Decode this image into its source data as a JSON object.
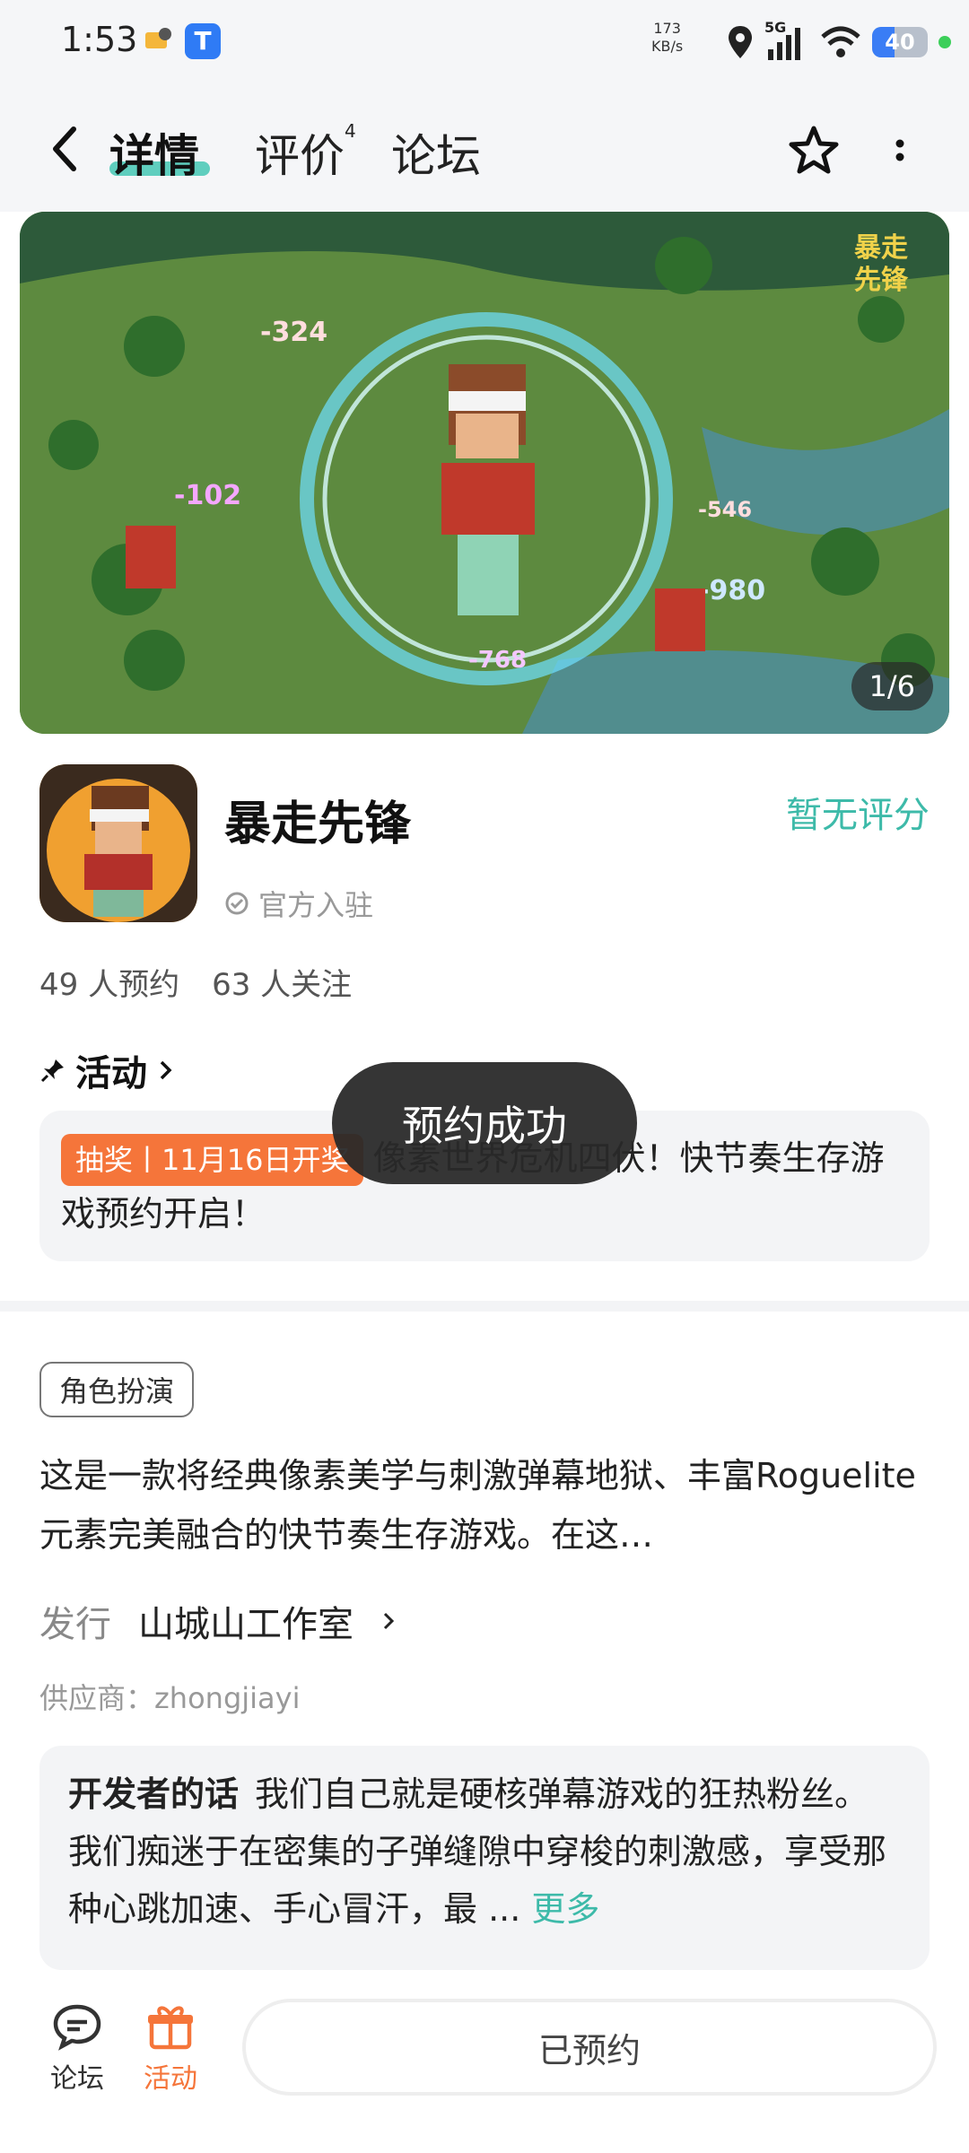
{
  "status_bar": {
    "time": "1:53",
    "net_speed_value": "173",
    "net_speed_unit": "KB/s",
    "network": "5G",
    "battery": "40",
    "icons": [
      "notification-app-icon",
      "app-t-icon",
      "location-icon",
      "signal-icon",
      "wifi-icon",
      "battery-icon"
    ]
  },
  "nav": {
    "tabs": [
      {
        "label": "详情",
        "active": true
      },
      {
        "label": "评价",
        "badge": "4"
      },
      {
        "label": "论坛"
      }
    ]
  },
  "banner": {
    "counter": "1/6",
    "watermark_line1": "暴走",
    "watermark_line2": "先锋",
    "damage_numbers": [
      "-324",
      "-102",
      "-546",
      "-980",
      "-768"
    ]
  },
  "app": {
    "name": "暴走先锋",
    "verified": "官方入驻",
    "rating": "暂无评分",
    "reservations": "49 人预约",
    "followers": "63 人关注"
  },
  "activity": {
    "title": "活动",
    "tag": "抽奖丨11月16日开奖",
    "text": "像素世界危机四伏！快节奏生存游戏预约开启！"
  },
  "toast": "预约成功",
  "details": {
    "genre": "角色扮演",
    "description": "这是一款将经典像素美学与刺激弹幕地狱、丰富Roguelite元素完美融合的快节奏生存游戏。在这…",
    "publisher_label": "发行",
    "publisher": "山城山工作室",
    "supplier": "供应商：zhongjiayi",
    "dev_title": "开发者的话",
    "dev_text": "我们自己就是硬核弹幕游戏的狂热粉丝。我们痴迷于在密集的子弹缝隙中穿梭的刺激感，享受那种心跳加速、手心冒汗，最 ...",
    "dev_more": "更多"
  },
  "bottom_bar": {
    "forum": "论坛",
    "activity": "活动",
    "reserved": "已预约"
  },
  "colors": {
    "accent": "#3dbaa9",
    "orange": "#f5753a",
    "card_bg": "#f3f4f6"
  }
}
